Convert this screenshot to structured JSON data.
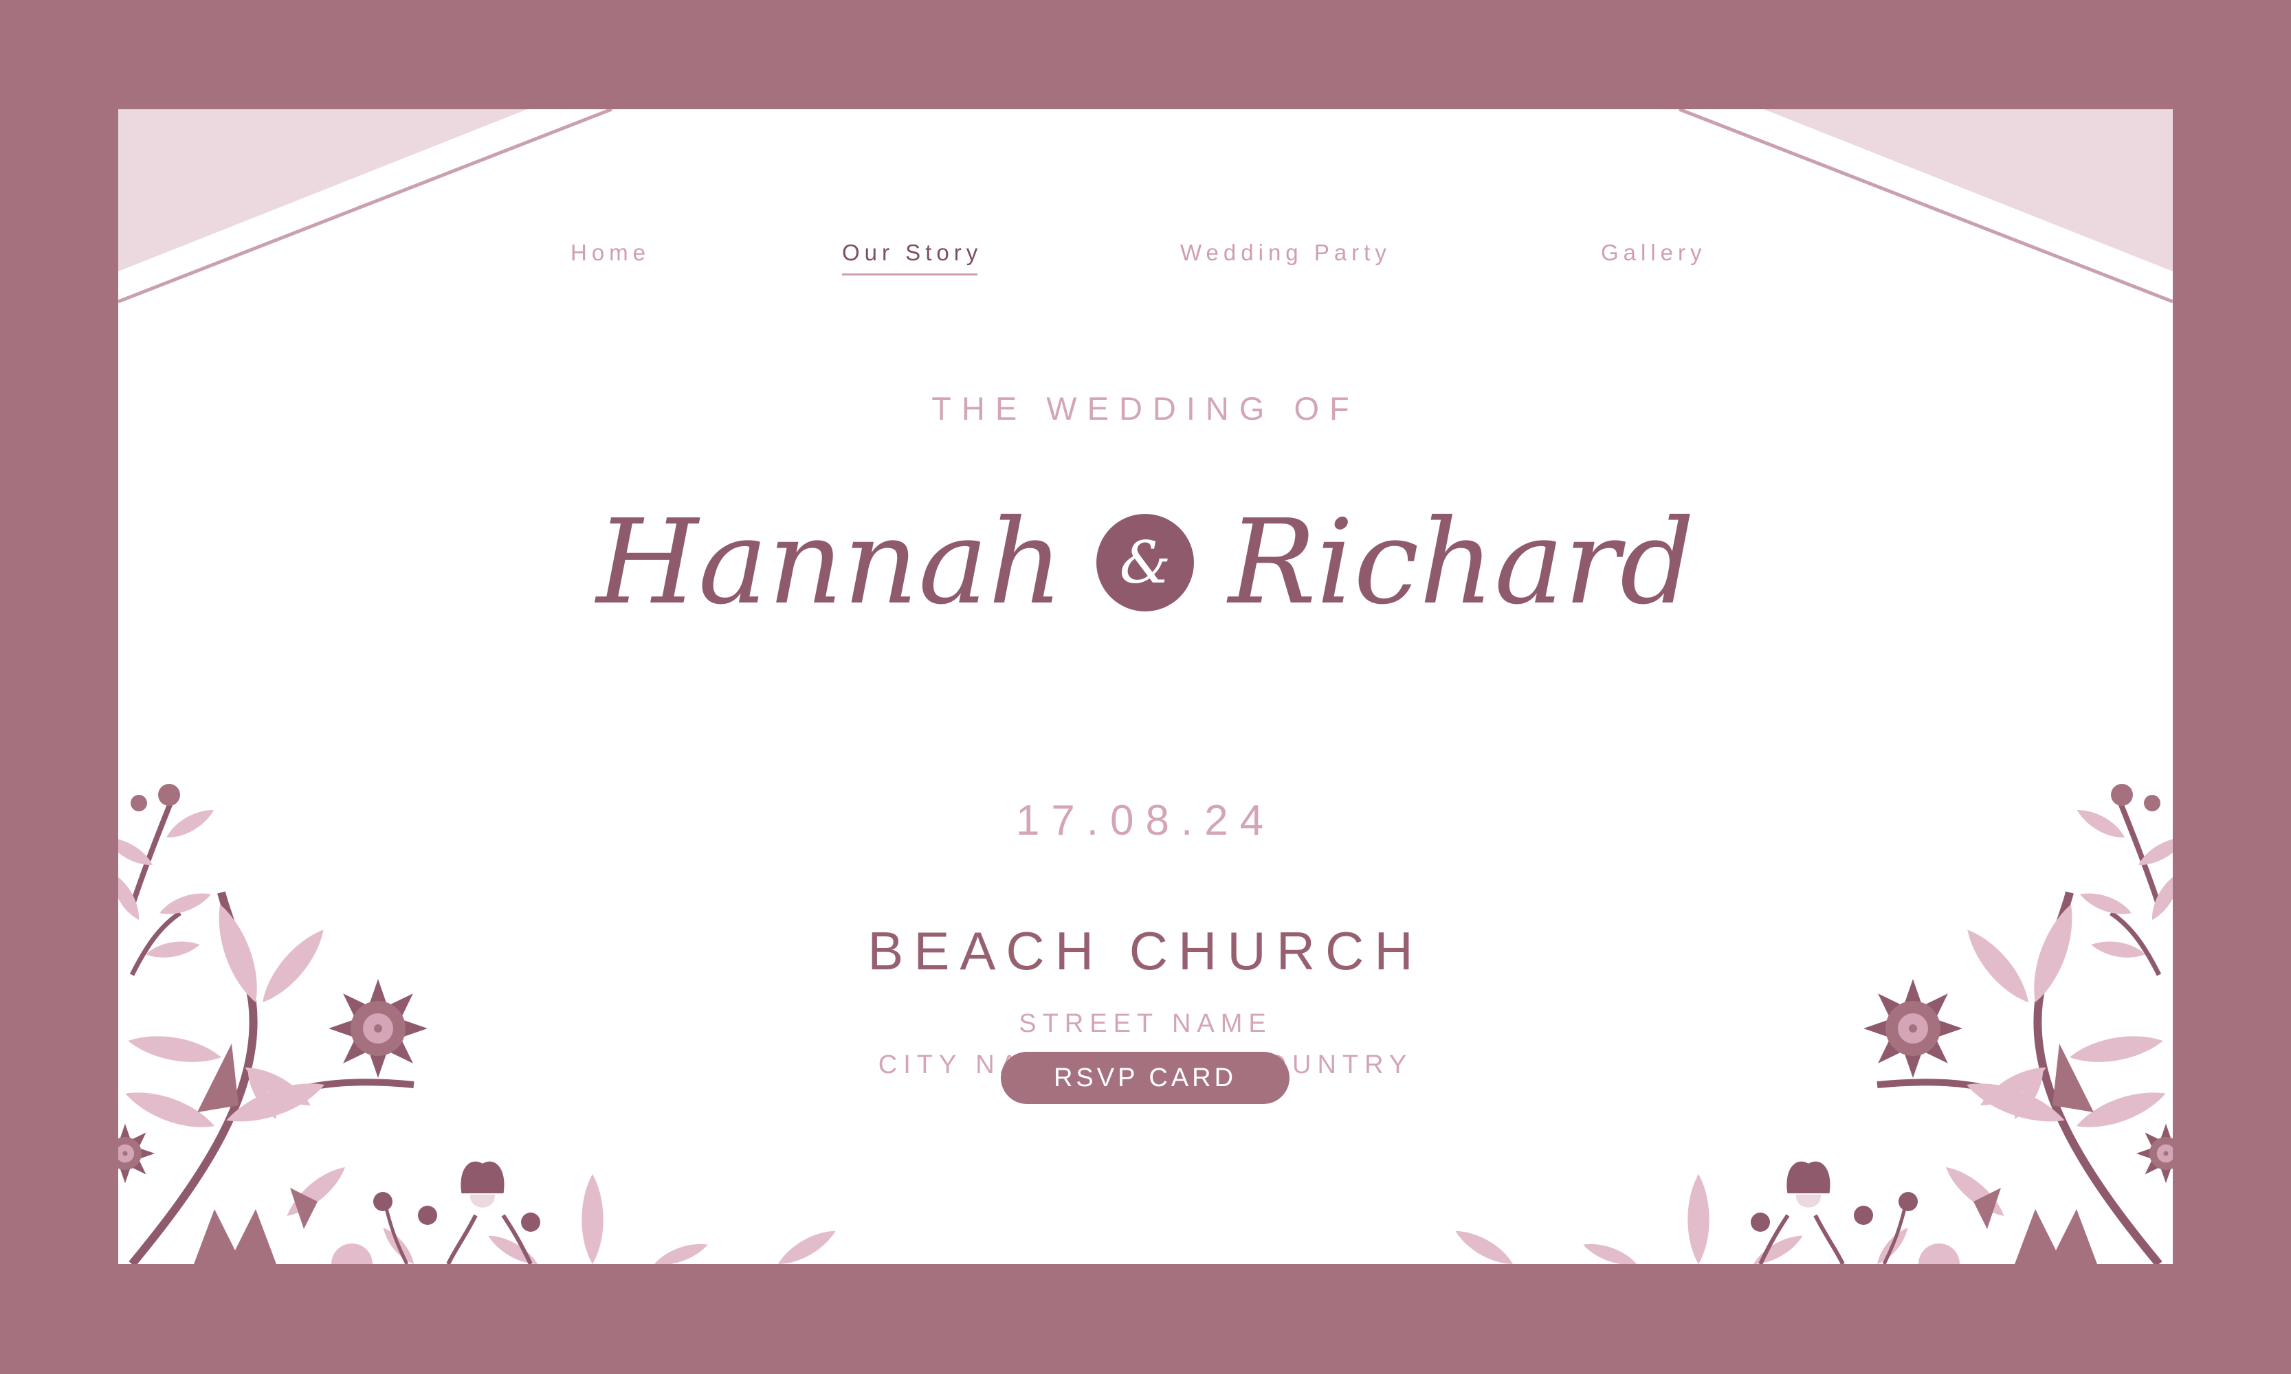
{
  "nav": {
    "items": [
      {
        "label": "Home"
      },
      {
        "label": "Our Story",
        "active": true
      },
      {
        "label": "Wedding Party"
      },
      {
        "label": "Gallery"
      }
    ]
  },
  "hero": {
    "overline": "THE WEDDING OF",
    "name_left": "Hannah",
    "ampersand": "&",
    "name_right": "Richard",
    "date": "17.08.24"
  },
  "venue": {
    "name": "BEACH CHURCH",
    "street": "STREET NAME",
    "city": "CITY NAME, STATE, COUNTRY"
  },
  "rsvp": {
    "label": "RSVP CARD"
  },
  "colors": {
    "frame": "#a5717f",
    "card": "#ffffff",
    "accent_dark": "#8f5a6b",
    "accent_light": "#d3a5b6",
    "petal_light": "#ebd9df"
  },
  "icons": [
    "flower-icon",
    "leaf-icon",
    "branch-icon"
  ]
}
